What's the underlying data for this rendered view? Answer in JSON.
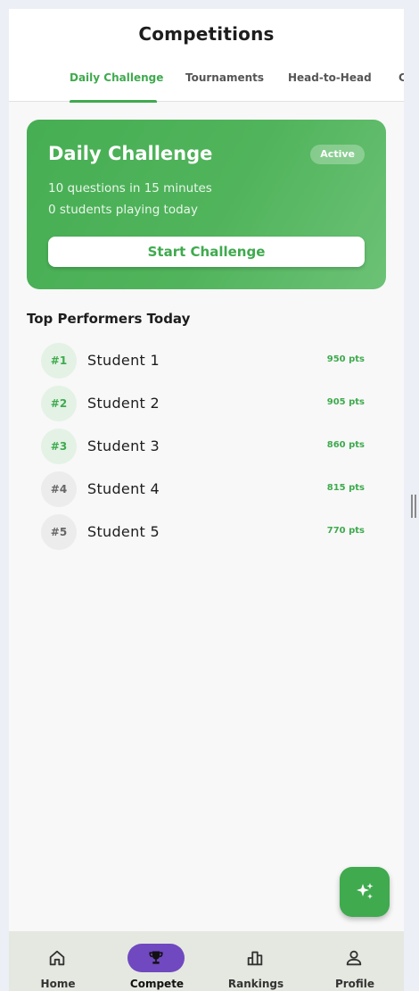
{
  "app": {
    "title": "Competitions"
  },
  "tabs": [
    {
      "label": "Daily Challenge",
      "active": true
    },
    {
      "label": "Tournaments",
      "active": false
    },
    {
      "label": "Head-to-Head",
      "active": false
    },
    {
      "label": "C",
      "active": false
    }
  ],
  "challenge": {
    "title": "Daily Challenge",
    "status": "Active",
    "line1": "10 questions in 15 minutes",
    "line2": "0 students playing today",
    "button_label": "Start Challenge"
  },
  "leaderboard": {
    "title": "Top Performers Today",
    "entries": [
      {
        "rank": "#1",
        "name": "Student 1",
        "points": "950 pts"
      },
      {
        "rank": "#2",
        "name": "Student 2",
        "points": "905 pts"
      },
      {
        "rank": "#3",
        "name": "Student 3",
        "points": "860 pts"
      },
      {
        "rank": "#4",
        "name": "Student 4",
        "points": "815 pts"
      },
      {
        "rank": "#5",
        "name": "Student 5",
        "points": "770 pts"
      }
    ]
  },
  "fab": {
    "icon": "sparkle-icon"
  },
  "nav": [
    {
      "label": "Home",
      "icon": "home-icon",
      "active": false
    },
    {
      "label": "Compete",
      "icon": "trophy-icon",
      "active": true
    },
    {
      "label": "Rankings",
      "icon": "bar-chart-icon",
      "active": false
    },
    {
      "label": "Profile",
      "icon": "person-icon",
      "active": false
    }
  ],
  "colors": {
    "accent": "#3faa4e",
    "nav_active": "#7048c0",
    "nav_bg": "#e5e8e0"
  }
}
